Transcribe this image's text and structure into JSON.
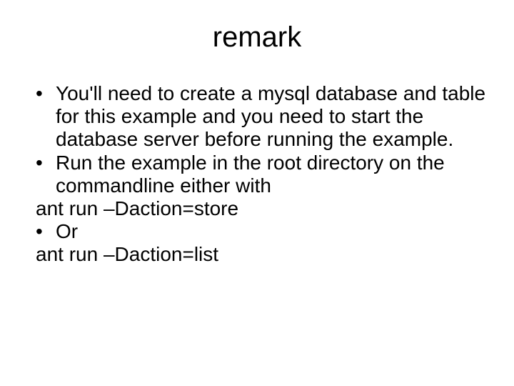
{
  "title": "remark",
  "bullets": {
    "b1": "You'll need to create a mysql database and table for this example and you need to start the database server before running the example.",
    "b2": "Run the example in the root directory on the commandline either with",
    "b3": "Or"
  },
  "lines": {
    "l1": "ant run –Daction=store",
    "l2": "ant run –Daction=list"
  }
}
